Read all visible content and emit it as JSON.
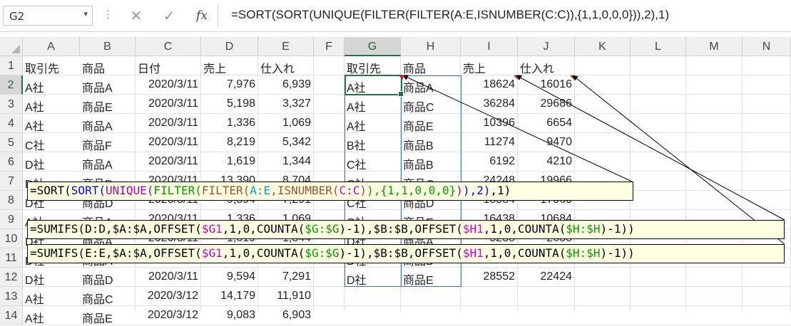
{
  "name_box": {
    "value": "G2",
    "dropdown": "▾"
  },
  "formula_bar": {
    "cancel_icon": "✕",
    "enter_icon": "✓",
    "fx_label": "fx",
    "formula": "=SORT(SORT(UNIQUE(FILTER(FILTER(A:E,ISNUMBER(C:C)),{1,1,0,0,0})),2),1)"
  },
  "columns": [
    "A",
    "B",
    "C",
    "D",
    "E",
    "F",
    "G",
    "H",
    "I",
    "J",
    "K",
    "L",
    "M",
    "N"
  ],
  "rows": [
    "1",
    "2",
    "3",
    "4",
    "5",
    "6",
    "7",
    "8",
    "9",
    "10",
    "11",
    "12",
    "13",
    "14"
  ],
  "selected_cell": {
    "col": "G",
    "row": "2"
  },
  "left_table": {
    "headers": [
      "取引先",
      "商品",
      "日付",
      "売上",
      "仕入れ"
    ],
    "rows": [
      [
        "A社",
        "商品A",
        "2020/3/11",
        "7,976",
        "6,939"
      ],
      [
        "A社",
        "商品E",
        "2020/3/11",
        "5,198",
        "3,327"
      ],
      [
        "A社",
        "商品A",
        "2020/3/11",
        "1,336",
        "1,069"
      ],
      [
        "C社",
        "商品F",
        "2020/3/11",
        "8,219",
        "5,342"
      ],
      [
        "D社",
        "商品A",
        "2020/3/11",
        "1,619",
        "1,344"
      ],
      [
        "D社",
        "商品D",
        "2020/3/11",
        "13,390",
        "8,704"
      ],
      [
        "D社",
        "商品D",
        "2020/3/11",
        "9,594",
        "7,291"
      ],
      [
        "A社",
        "商品A",
        "2020/3/11",
        "1,336",
        "1,069"
      ],
      [
        "D社",
        "商品A",
        "2020/3/11",
        "1,619",
        "1,344"
      ],
      [
        "D社",
        "商品A",
        "2020/3/11",
        "1,619",
        "1,344"
      ],
      [
        "D社",
        "商品D",
        "2020/3/11",
        "9,594",
        "7,291"
      ],
      [
        "A社",
        "商品C",
        "2020/3/12",
        "14,179",
        "11,910"
      ],
      [
        "A社",
        "商品E",
        "2020/3/12",
        "9,083",
        "6,903"
      ]
    ]
  },
  "right_table": {
    "headers": [
      "取引先",
      "商品",
      "売上",
      "仕入れ"
    ],
    "rows": [
      [
        "A社",
        "商品A",
        "18624",
        "16016"
      ],
      [
        "A社",
        "商品C",
        "36284",
        "29686"
      ],
      [
        "A社",
        "商品E",
        "10396",
        "6654"
      ],
      [
        "B社",
        "商品B",
        "11274",
        "9470"
      ],
      [
        "C社",
        "商品B",
        "6192",
        "4210"
      ],
      [
        "C社",
        "商品C",
        "24248",
        "19966"
      ],
      [
        "C社",
        "商品D",
        "18584",
        "17060"
      ],
      [
        "C社",
        "商品E",
        "16438",
        "10684"
      ],
      [
        "D社",
        "商品A",
        "5238",
        "2688"
      ],
      [
        "D社",
        "商品D",
        "",
        ""
      ],
      [
        "D社",
        "商品E",
        "28552",
        "22424"
      ]
    ]
  },
  "formula_overlays": [
    {
      "tokens": [
        {
          "t": "=SORT(",
          "c": "#000000"
        },
        {
          "t": "SORT(",
          "c": "#0000ff"
        },
        {
          "t": "UNIQUE(",
          "c": "#b000b0"
        },
        {
          "t": "FILTER(",
          "c": "#00a000"
        },
        {
          "t": "FILTER(",
          "c": "#a0522d"
        },
        {
          "t": "A:E",
          "c": "#00a0d0"
        },
        {
          "t": ",ISNUMBER(",
          "c": "#a0522d"
        },
        {
          "t": "C:C",
          "c": "#d000d0"
        },
        {
          "t": ")",
          "c": "#a0522d"
        },
        {
          "t": "),{1,1,0,0,0}",
          "c": "#00a000"
        },
        {
          "t": ")",
          "c": "#b000b0"
        },
        {
          "t": "),2)",
          "c": "#0000ff"
        },
        {
          "t": ",1)",
          "c": "#000000"
        }
      ]
    },
    {
      "tokens": [
        {
          "t": "=SUMIFS(D:D,$A:$A,OFFSET(",
          "c": "#000000"
        },
        {
          "t": "$G1",
          "c": "#d000d0"
        },
        {
          "t": ",1,0,COUNTA(",
          "c": "#000000"
        },
        {
          "t": "$G:$G",
          "c": "#00a000"
        },
        {
          "t": ")-1),$B:$B,OFFSET(",
          "c": "#000000"
        },
        {
          "t": "$H1",
          "c": "#d000d0"
        },
        {
          "t": ",1,0,COUNTA(",
          "c": "#000000"
        },
        {
          "t": "$H:$H",
          "c": "#00a000"
        },
        {
          "t": ")-1))",
          "c": "#000000"
        }
      ]
    },
    {
      "tokens": [
        {
          "t": "=SUMIFS(E:E,$A:$A,OFFSET(",
          "c": "#000000"
        },
        {
          "t": "$G1",
          "c": "#d000d0"
        },
        {
          "t": ",1,0,COUNTA(",
          "c": "#000000"
        },
        {
          "t": "$G:$G",
          "c": "#00a000"
        },
        {
          "t": ")-1),$B:$B,OFFSET(",
          "c": "#000000"
        },
        {
          "t": "$H1",
          "c": "#d000d0"
        },
        {
          "t": ",1,0,COUNTA(",
          "c": "#000000"
        },
        {
          "t": "$H:$H",
          "c": "#00a000"
        },
        {
          "t": ")-1))",
          "c": "#000000"
        }
      ]
    }
  ]
}
